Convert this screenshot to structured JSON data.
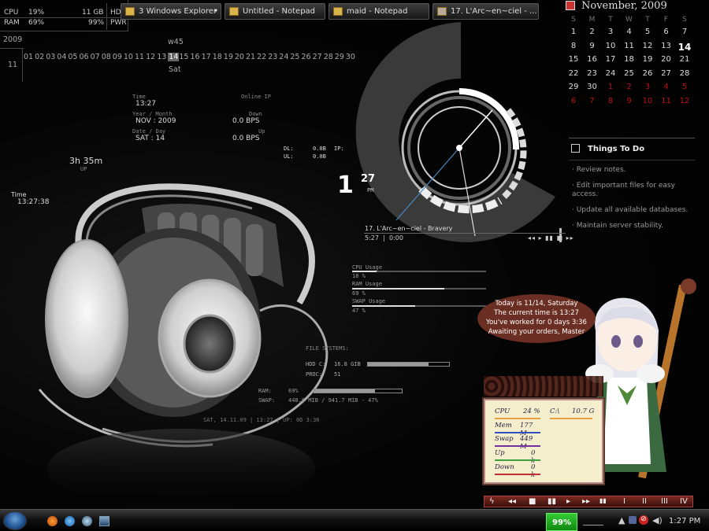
{
  "sysinfo": {
    "cpu_label": "CPU",
    "cpu_val": "19%",
    "ram_label": "RAM",
    "ram_val": "69%",
    "hdd_val": "11 GB",
    "pwr_val": "99%",
    "hdd_label": "HDD",
    "pwr_label": "PWR"
  },
  "strip": {
    "year": "2009",
    "month": "11",
    "week": "w45",
    "weekday": "Sat",
    "days": [
      "01",
      "02",
      "03",
      "04",
      "05",
      "06",
      "07",
      "08",
      "09",
      "10",
      "11",
      "12",
      "13",
      "14",
      "15",
      "16",
      "17",
      "18",
      "19",
      "20",
      "21",
      "22",
      "23",
      "24",
      "25",
      "26",
      "27",
      "28",
      "29",
      "30"
    ],
    "today_index": 13
  },
  "info": {
    "time_label": "Time",
    "time_val": "13:27",
    "ym_label": "Year / Month",
    "ym_val": "NOV : 2009",
    "dd_label": "Date / Day",
    "dd_val": "SAT : 14",
    "ip_label": "Online IP",
    "down_label": "Down",
    "down_val": "0.0 BPS",
    "up_label": "Up",
    "up_val": "0.0 BPS",
    "uptime": "3h 35m",
    "uptime_label": "UP",
    "time2_label": "Time",
    "time2_val": "13:27:38"
  },
  "net": {
    "dl_label": "DL:",
    "dl_val": "0.0B",
    "ul_label": "UL:",
    "ul_val": "0.0B",
    "ip_label": "IP:"
  },
  "clock": {
    "hour": "1",
    "min": "27",
    "ampm": "PM"
  },
  "player": {
    "track": "17. L'Arc~en~ciel - Bravery",
    "pos": "5:27",
    "dur": "0:00",
    "progress": 0.0
  },
  "usage": {
    "cpu_label": "CPU Usage",
    "cpu_val": "18 %",
    "cpu": 0.18,
    "ram_label": "RAM Usage",
    "ram_val": "69 %",
    "ram": 0.69,
    "swap_label": "SWAP Usage",
    "swap_val": "47 %",
    "swap": 0.47
  },
  "fs": {
    "title": "FILE SYSTEMS:",
    "hdd_label": "HDD C:",
    "hdd_val": "16.8 GIB",
    "hdd": 0.75,
    "proc_label": "PROC:",
    "proc_val": "51",
    "ram_label": "RAM:",
    "ram_val": "69%",
    "ram": 0.69,
    "swap_label": "SWAP:",
    "swap_val": "448.8 MIB / 941.7 MIB - 47%",
    "swap": 0.47,
    "footer": "SAT, 14.11.09 | 13:27 | UP: 0D 3:36"
  },
  "calendar": {
    "title": "November, 2009",
    "weekdays": [
      "S",
      "M",
      "T",
      "W",
      "T",
      "F",
      "S"
    ],
    "rows": [
      [
        "1",
        "2",
        "3",
        "4",
        "5",
        "6",
        "7"
      ],
      [
        "8",
        "9",
        "10",
        "11",
        "12",
        "13",
        "14"
      ],
      [
        "15",
        "16",
        "17",
        "18",
        "19",
        "20",
        "21"
      ],
      [
        "22",
        "23",
        "24",
        "25",
        "26",
        "27",
        "28"
      ],
      [
        "29",
        "30",
        "1",
        "2",
        "3",
        "4",
        "5"
      ],
      [
        "6",
        "7",
        "8",
        "9",
        "10",
        "11",
        "12"
      ]
    ]
  },
  "todo": {
    "title": "Things To Do",
    "items": [
      "· Review notes.",
      "· Edit important files for easy access.",
      "· Update all available databases.",
      "· Maintain server stability."
    ]
  },
  "bubble": {
    "lines": [
      "Today is 11/14, Saturday",
      "The current time is 13:27",
      "You've worked for 0 days 3:36",
      "Awaiting your orders, Master"
    ]
  },
  "meter": {
    "cpu_label": "CPU",
    "cpu_val": "24 %",
    "c_label": "C:\\",
    "c_val": "10.7 G",
    "mem_label": "Mem",
    "mem_val": "177 M",
    "swap_label": "Swap",
    "swap_val": "449 M",
    "up_label": "Up",
    "up_val": "0 k",
    "down_label": "Down",
    "down_val": "0 k"
  },
  "mediabar": {
    "roman": [
      "I",
      "II",
      "III",
      "IV"
    ]
  },
  "taskbar": {
    "explorer": "Windows Explorer",
    "explorer_count": "3",
    "notepad1": "Untitled - Notepad",
    "notepad2": "maid - Notepad",
    "winamp": "17. L'Arc~en~ciel - ...",
    "battery": "99%",
    "clock": "1:27 PM"
  },
  "colors": {
    "accent": "#d0d0d0",
    "red": "#b11111",
    "meter_bg": "#f4eecd",
    "bubble": "#6a2e22",
    "battery": "#22aa22"
  }
}
